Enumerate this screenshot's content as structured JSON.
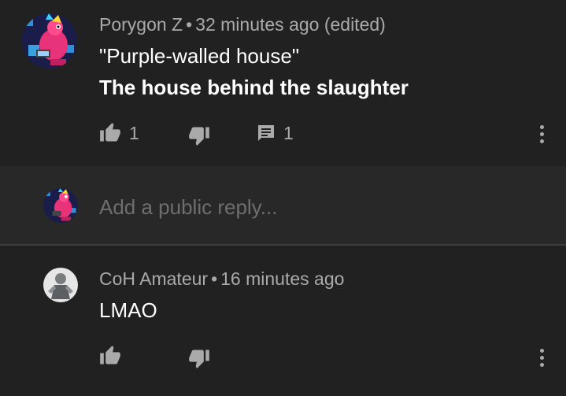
{
  "comments": [
    {
      "author": "Porygon Z",
      "separator": "•",
      "time": "32 minutes ago (edited)",
      "text_line_1": "\"Purple-walled house\"",
      "text_line_2": "The house behind the slaughter",
      "like_count": "1",
      "reply_count": "1",
      "avatar_icon": "porygon-z-avatar-icon"
    },
    {
      "author": "CoH Amateur",
      "separator": "•",
      "time": "16 minutes ago",
      "text_line_1": "LMAO",
      "avatar_icon": "grey-figure-avatar-icon"
    }
  ],
  "reply_box": {
    "placeholder": "Add a public reply..."
  },
  "colors": {
    "background": "#212121",
    "reply_background": "#282828",
    "secondary_text": "#aaaaaa",
    "primary_text": "#ffffff"
  }
}
